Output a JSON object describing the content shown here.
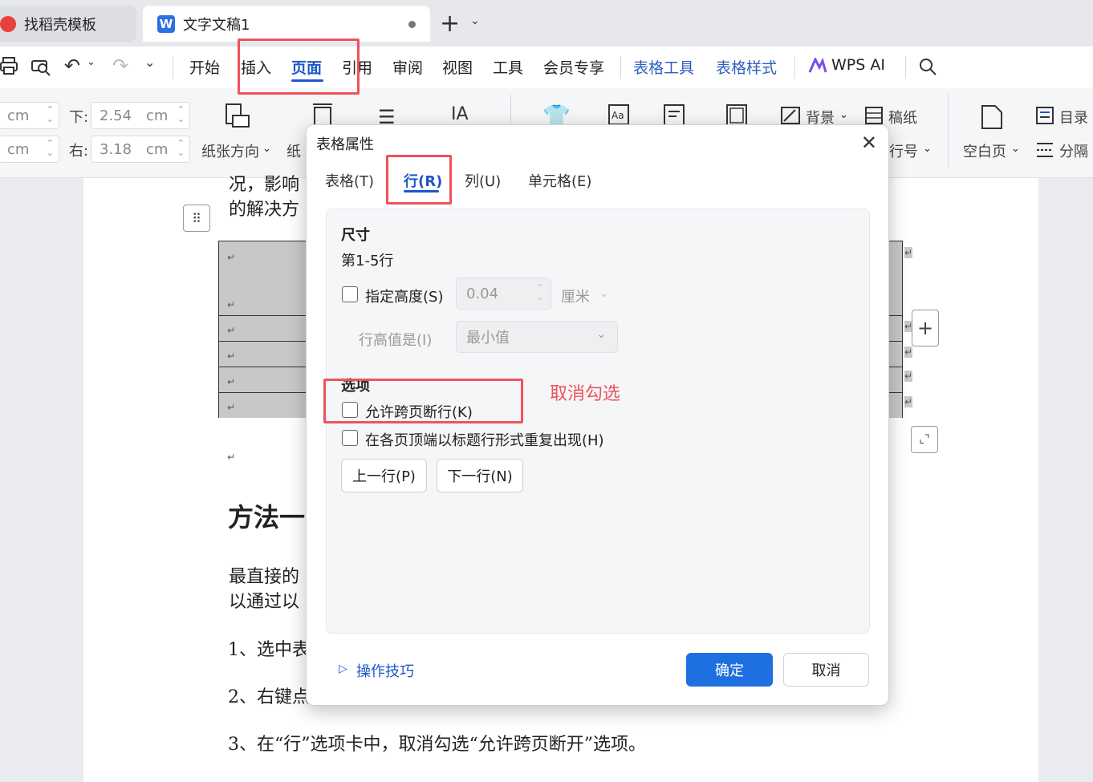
{
  "tabs": {
    "template": "找稻壳模板",
    "doc": "文字文稿1",
    "doc_logo": "W",
    "new_tab": "+"
  },
  "menu": [
    "开始",
    "插入",
    "页面",
    "引用",
    "审阅",
    "视图",
    "工具",
    "会员专享",
    "表格工具",
    "表格样式",
    "WPS AI"
  ],
  "ribbon": {
    "unit": "cm",
    "bottom_label": "下:",
    "bottom_value": "2.54",
    "right_label": "右:",
    "right_value": "3.18",
    "orientation": "纸张方向",
    "size_partial": "纸",
    "background": "背景",
    "draft_paper": "稿纸",
    "line_number": "行号",
    "blank_page": "空白页",
    "toc": "目录",
    "separator": "分隔"
  },
  "doc": {
    "line1": "况，影响",
    "line2": "的解决方",
    "heading": "方法一",
    "para1": "最直接的",
    "para2": "以通过以",
    "step1": "1、选中表",
    "step2": "2、右键点",
    "step3": "3、在“行”选项卡中，取消勾选“允许跨页断开”选项。"
  },
  "dialog": {
    "title": "表格属性",
    "tabs": [
      "表格(T)",
      "行(R)",
      "列(U)",
      "单元格(E)"
    ],
    "size_heading": "尺寸",
    "rows_label": "第1-5行",
    "specify_height": "指定高度(S)",
    "height_value": "0.04",
    "height_unit": "厘米",
    "row_height_is": "行高值是(I)",
    "row_height_mode": "最小值",
    "options_heading": "选项",
    "allow_break": "允许跨页断行(K)",
    "repeat_header": "在各页顶端以标题行形式重复出现(H)",
    "prev_row": "上一行(P)",
    "next_row": "下一行(N)",
    "tips": "操作技巧",
    "ok": "确定",
    "cancel": "取消",
    "allow_break_checked": false,
    "repeat_header_checked": false,
    "specify_height_checked": false
  },
  "annotation": "取消勾选",
  "colors": {
    "accent": "#1e56c8",
    "highlight": "#f0525c"
  }
}
